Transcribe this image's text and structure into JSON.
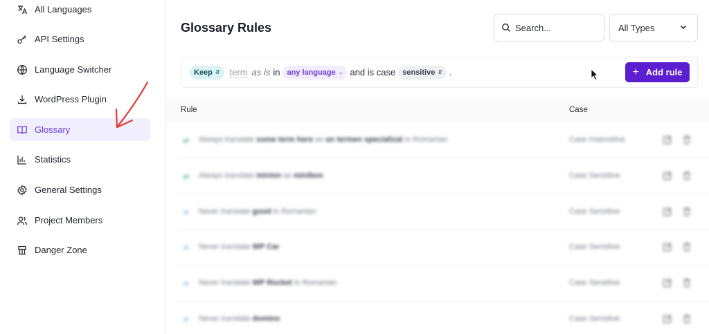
{
  "sidebar": {
    "items": [
      {
        "label": "All Languages",
        "icon": "translate-icon",
        "active": false
      },
      {
        "label": "API Settings",
        "icon": "key-icon",
        "active": false
      },
      {
        "label": "Language Switcher",
        "icon": "globe-icon",
        "active": false
      },
      {
        "label": "WordPress Plugin",
        "icon": "download-icon",
        "active": false
      },
      {
        "label": "Glossary",
        "icon": "book-icon",
        "active": true
      },
      {
        "label": "Statistics",
        "icon": "bar-chart-icon",
        "active": false
      },
      {
        "label": "General Settings",
        "icon": "gear-icon",
        "active": false
      },
      {
        "label": "Project Members",
        "icon": "users-icon",
        "active": false
      },
      {
        "label": "Danger Zone",
        "icon": "danger-icon",
        "active": false
      }
    ]
  },
  "header": {
    "title": "Glossary Rules",
    "search_placeholder": "Search...",
    "type_filter": "All Types"
  },
  "builder": {
    "action": "Keep",
    "term_placeholder": "term",
    "as_is": "as is",
    "in_text": "in",
    "language": "any language",
    "case_text": "and is case",
    "case_value": "sensitive",
    "period": ".",
    "add_button": "Add rule"
  },
  "table": {
    "columns": {
      "rule": "Rule",
      "case": "Case"
    },
    "rows": [
      {
        "prefix": "Always translate",
        "term": "some term here",
        "mid": "as",
        "target": "un termen specializat",
        "suffix": "in Romanian",
        "case": "Case Insensitive",
        "icon_color": "#3bb07a"
      },
      {
        "prefix": "Always translate",
        "term": "minion",
        "mid": "as",
        "target": "minibon",
        "suffix": "",
        "case": "Case Sensitive",
        "icon_color": "#3bb07a"
      },
      {
        "prefix": "Never translate",
        "term": "good",
        "mid": "",
        "target": "",
        "suffix": "in Romanian",
        "case": "Case Sensitive",
        "icon_color": "#5aa9e6"
      },
      {
        "prefix": "Never translate",
        "term": "WP Car",
        "mid": "",
        "target": "",
        "suffix": "",
        "case": "Case Sensitive",
        "icon_color": "#5aa9e6"
      },
      {
        "prefix": "Never translate",
        "term": "WP Rocket",
        "mid": "",
        "target": "",
        "suffix": "in Romanian",
        "case": "Case Sensitive",
        "icon_color": "#5aa9e6"
      },
      {
        "prefix": "Never translate",
        "term": "domino",
        "mid": "",
        "target": "",
        "suffix": "",
        "case": "Case Sensitive",
        "icon_color": "#5aa9e6"
      }
    ]
  },
  "colors": {
    "accent": "#5b1ed0",
    "active_bg": "#f1effd",
    "annotation": "#e53935"
  }
}
